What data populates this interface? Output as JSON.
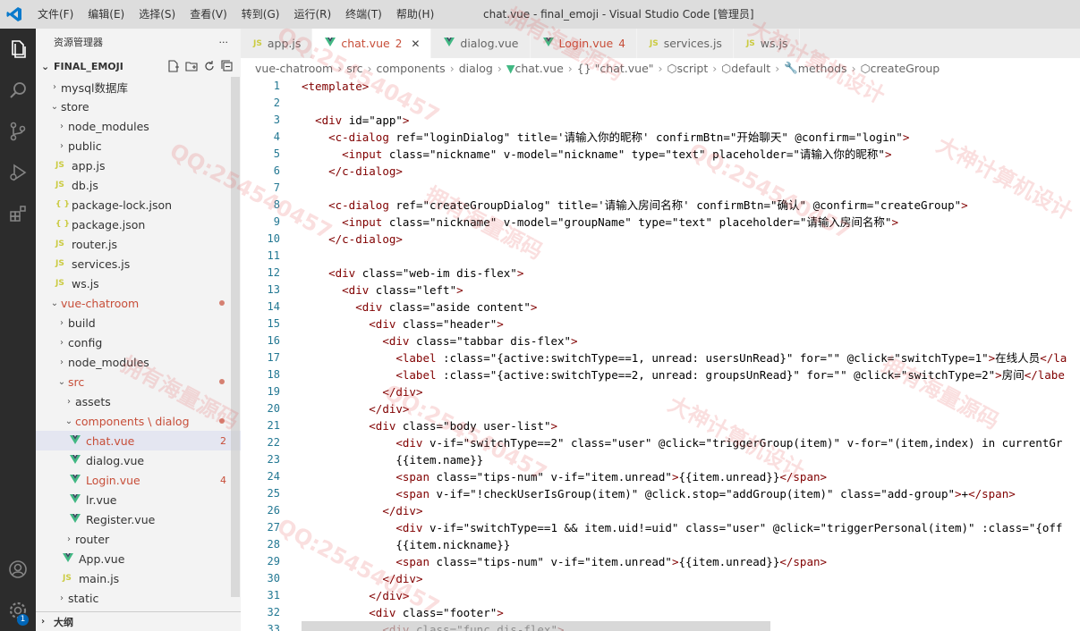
{
  "titlebar": {
    "menu": [
      "文件(F)",
      "编辑(E)",
      "选择(S)",
      "查看(V)",
      "转到(G)",
      "运行(R)",
      "终端(T)",
      "帮助(H)"
    ],
    "title": "chat.vue - final_emoji - Visual Studio Code [管理员]"
  },
  "activity_badge": "1",
  "sidebar": {
    "header": "资源管理器",
    "more": "···",
    "project": "FINAL_EMOJI",
    "outline": "大纲",
    "tree": [
      {
        "depth": 1,
        "type": "folder",
        "open": false,
        "label": "mysql数据库"
      },
      {
        "depth": 1,
        "type": "folder",
        "open": true,
        "label": "store"
      },
      {
        "depth": 2,
        "type": "folder",
        "open": false,
        "label": "node_modules"
      },
      {
        "depth": 2,
        "type": "folder",
        "open": false,
        "label": "public"
      },
      {
        "depth": 2,
        "type": "js",
        "label": "app.js"
      },
      {
        "depth": 2,
        "type": "js",
        "label": "db.js"
      },
      {
        "depth": 2,
        "type": "json",
        "label": "package-lock.json"
      },
      {
        "depth": 2,
        "type": "json",
        "label": "package.json"
      },
      {
        "depth": 2,
        "type": "js",
        "label": "router.js"
      },
      {
        "depth": 2,
        "type": "js",
        "label": "services.js"
      },
      {
        "depth": 2,
        "type": "js",
        "label": "ws.js"
      },
      {
        "depth": 1,
        "type": "folder",
        "open": true,
        "label": "vue-chatroom",
        "modified": true
      },
      {
        "depth": 2,
        "type": "folder",
        "open": false,
        "label": "build"
      },
      {
        "depth": 2,
        "type": "folder",
        "open": false,
        "label": "config"
      },
      {
        "depth": 2,
        "type": "folder",
        "open": false,
        "label": "node_modules"
      },
      {
        "depth": 2,
        "type": "folder",
        "open": true,
        "label": "src",
        "modified": true
      },
      {
        "depth": 3,
        "type": "folder",
        "open": false,
        "label": "assets"
      },
      {
        "depth": 3,
        "type": "folder",
        "open": true,
        "label": "components \\ dialog",
        "modified": true
      },
      {
        "depth": 4,
        "type": "vue",
        "label": "chat.vue",
        "count": "2",
        "selected": true
      },
      {
        "depth": 4,
        "type": "vue",
        "label": "dialog.vue"
      },
      {
        "depth": 4,
        "type": "vue",
        "label": "Login.vue",
        "count": "4"
      },
      {
        "depth": 4,
        "type": "vue",
        "label": "lr.vue"
      },
      {
        "depth": 4,
        "type": "vue",
        "label": "Register.vue"
      },
      {
        "depth": 3,
        "type": "folder",
        "open": false,
        "label": "router"
      },
      {
        "depth": 3,
        "type": "vue",
        "label": "App.vue"
      },
      {
        "depth": 3,
        "type": "js",
        "label": "main.js"
      },
      {
        "depth": 2,
        "type": "folder",
        "open": false,
        "label": "static"
      }
    ]
  },
  "tabs": [
    {
      "label": "app.js",
      "type": "js"
    },
    {
      "label": "chat.vue",
      "type": "vue",
      "count": "2",
      "active": true,
      "close": "✕"
    },
    {
      "label": "dialog.vue",
      "type": "vue"
    },
    {
      "label": "Login.vue",
      "type": "vue",
      "count": "4"
    },
    {
      "label": "services.js",
      "type": "js"
    },
    {
      "label": "ws.js",
      "type": "js"
    }
  ],
  "breadcrumb": [
    "vue-chatroom",
    "src",
    "components",
    "dialog",
    "chat.vue",
    "{} \"chat.vue\"",
    "script",
    "default",
    "methods",
    "createGroup"
  ],
  "lines": [
    "<template>",
    "",
    "  <div id=\"app\">",
    "    <c-dialog ref=\"loginDialog\" title='请输入你的昵称' confirmBtn=\"开始聊天\" @confirm=\"login\">",
    "      <input class=\"nickname\" v-model=\"nickname\" type=\"text\" placeholder=\"请输入你的昵称\">",
    "    </c-dialog>",
    "",
    "    <c-dialog ref=\"createGroupDialog\" title='请输入房间名称' confirmBtn=\"确认\" @confirm=\"createGroup\">",
    "      <input class=\"nickname\" v-model=\"groupName\" type=\"text\" placeholder=\"请输入房间名称\">",
    "    </c-dialog>",
    "",
    "    <div class=\"web-im dis-flex\">",
    "      <div class=\"left\">",
    "        <div class=\"aside content\">",
    "          <div class=\"header\">",
    "            <div class=\"tabbar dis-flex\">",
    "              <label :class=\"{active:switchType==1, unread: usersUnRead}\" for=\"\" @click=\"switchType=1\">在线人员</la",
    "              <label :class=\"{active:switchType==2, unread: groupsUnRead}\" for=\"\" @click=\"switchType=2\">房间</labe",
    "            </div>",
    "          </div>",
    "          <div class=\"body user-list\">",
    "              <div v-if=\"switchType==2\" class=\"user\" @click=\"triggerGroup(item)\" v-for=\"(item,index) in currentGr",
    "              {{item.name}}",
    "              <span class=\"tips-num\" v-if=\"item.unread\">{{item.unread}}</span>",
    "              <span v-if=\"!checkUserIsGroup(item)\" @click.stop=\"addGroup(item)\" class=\"add-group\">+</span>",
    "            </div>",
    "              <div v-if=\"switchType==1 && item.uid!=uid\" class=\"user\" @click=\"triggerPersonal(item)\" :class=\"{off",
    "              {{item.nickname}}",
    "              <span class=\"tips-num\" v-if=\"item.unread\">{{item.unread}}</span>",
    "            </div>",
    "          </div>",
    "          <div class=\"footer\">",
    "            <div class=\"func dis-flex\">"
  ],
  "watermarks": [
    "QQ:254540457",
    "拥有海量源码",
    "大神计算机设计",
    "QQ:254540457",
    "拥有海量源码",
    "QQ:254540457",
    "大神计算机设计",
    "拥有海量源码",
    "QQ:254540457",
    "大神计算机设计",
    "拥有海量源码",
    "QQ:254540457"
  ]
}
